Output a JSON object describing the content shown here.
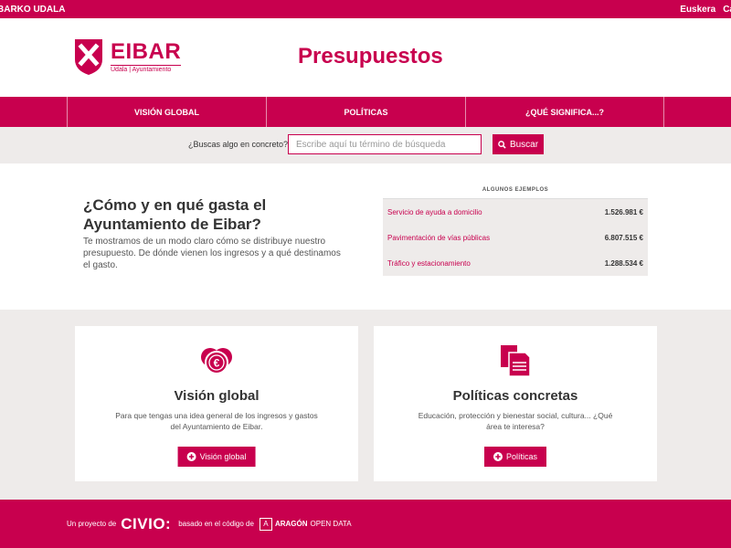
{
  "topbar": {
    "site_name": "BARKO UDALA",
    "languages": [
      "Euskera",
      "Ca"
    ]
  },
  "header": {
    "brand_name": "EIBAR",
    "brand_sub": "Udala | Ayuntamiento",
    "title": "Presupuestos"
  },
  "nav": {
    "items": [
      "VISIÓN GLOBAL",
      "POLÍTICAS",
      "¿QUÉ SIGNIFICA...?"
    ]
  },
  "search": {
    "label": "¿Buscas algo en concreto?",
    "placeholder": "Escribe aquí tu término de búsqueda",
    "button": "Buscar"
  },
  "intro": {
    "heading": "¿Cómo y en qué gasta el Ayuntamiento de Eibar?",
    "text": "Te mostramos de un modo claro cómo se distribuye nuestro presupuesto. De dónde vienen los ingresos y a qué destinamos el gasto."
  },
  "examples": {
    "header": "ALGUNOS EJEMPLOS",
    "rows": [
      {
        "name": "Servicio de ayuda a domicilio",
        "amount": "1.526.981 €"
      },
      {
        "name": "Pavimentación de vías públicas",
        "amount": "6.807.515 €"
      },
      {
        "name": "Tráfico y estacionamiento",
        "amount": "1.288.534 €"
      }
    ]
  },
  "cards": {
    "left": {
      "title": "Visión global",
      "desc": "Para que tengas una idea general de los ingresos y gastos del Ayuntamiento de Eibar.",
      "button": "Visión global"
    },
    "right": {
      "title": "Políticas concretas",
      "desc": "Educación, protección y bienestar social, cultura... ¿Qué área te interesa?",
      "button": "Políticas"
    }
  },
  "footer": {
    "project_of": "Un proyecto de",
    "civio": "CIVIO:",
    "based_on": "basado en el código de",
    "aragon_letter": "A",
    "aragon": "ARAGÓN",
    "aragon_sub": "OPEN DATA"
  },
  "colors": {
    "brand": "#c8004e",
    "light_bg": "#eeebea"
  }
}
